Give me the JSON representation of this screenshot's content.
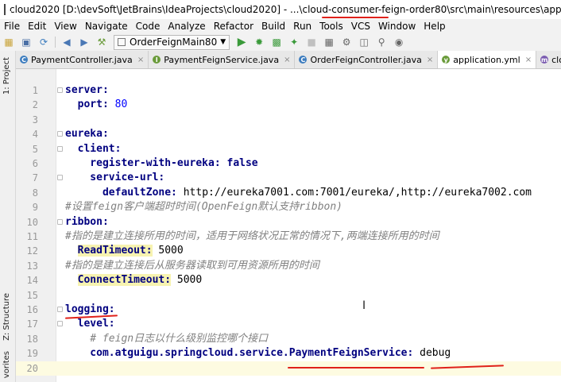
{
  "window": {
    "title_pre": "cloud2020 [D:\\devSoft\\JetBrains\\IdeaProjects\\cloud2020] - ...\\cloud-consumer-",
    "title_hl": "feign-order80\\src",
    "title_post": "\\main\\resources\\application.yml [cloud-cons"
  },
  "menu": [
    "File",
    "Edit",
    "View",
    "Navigate",
    "Code",
    "Analyze",
    "Refactor",
    "Build",
    "Run",
    "Tools",
    "VCS",
    "Window",
    "Help"
  ],
  "toolbar": {
    "run_config": "OrderFeignMain80"
  },
  "sidebar": {
    "project_label": "1: Project",
    "structure_label": "Z: Structure",
    "favorites_label": "vorites"
  },
  "tabs": [
    {
      "label": "PaymentController.java",
      "icon": "class-icon",
      "color": "#3d7dbf"
    },
    {
      "label": "PaymentFeignService.java",
      "icon": "interface-icon",
      "color": "#6a9b3a"
    },
    {
      "label": "OrderFeignController.java",
      "icon": "class-icon",
      "color": "#3d7dbf"
    },
    {
      "label": "application.yml",
      "icon": "yaml-icon",
      "color": "#6a9b3a",
      "active": true
    },
    {
      "label": "cloud-consum",
      "icon": "maven-icon",
      "color": "#7a5bb0"
    }
  ],
  "editor": {
    "lines": [
      {
        "n": "1",
        "parts": [
          {
            "t": "server:",
            "c": "k"
          }
        ]
      },
      {
        "n": "2",
        "parts": [
          {
            "t": "  port: ",
            "c": "k"
          },
          {
            "t": "80",
            "c": "v"
          }
        ]
      },
      {
        "n": "3",
        "parts": []
      },
      {
        "n": "4",
        "parts": [
          {
            "t": "eureka:",
            "c": "k"
          }
        ]
      },
      {
        "n": "5",
        "parts": [
          {
            "t": "  client:",
            "c": "k"
          }
        ]
      },
      {
        "n": "6",
        "parts": [
          {
            "t": "    register-with-eureka: ",
            "c": "k"
          },
          {
            "t": "false",
            "c": "k"
          }
        ]
      },
      {
        "n": "7",
        "parts": [
          {
            "t": "    service-url:",
            "c": "k"
          }
        ]
      },
      {
        "n": "8",
        "parts": [
          {
            "t": "      defaultZone: ",
            "c": "k"
          },
          {
            "t": "http://eureka7001.com:7001/eureka/,http://eureka7002.com",
            "c": "s"
          }
        ]
      },
      {
        "n": "9",
        "parts": [
          {
            "t": "#设置feign客户端超时时间(OpenFeign默认支持ribbon)",
            "c": "c"
          }
        ]
      },
      {
        "n": "10",
        "parts": [
          {
            "t": "ribbon:",
            "c": "k"
          }
        ]
      },
      {
        "n": "11",
        "parts": [
          {
            "t": "#指的是建立连接所用的时间，适用于网络状况正常的情况下,两端连接所用的时间",
            "c": "c"
          }
        ]
      },
      {
        "n": "12",
        "parts": [
          {
            "t": "  ",
            "c": "s"
          },
          {
            "t": "ReadTimeout:",
            "c": "hlkey"
          },
          {
            "t": " 5000",
            "c": "s"
          }
        ]
      },
      {
        "n": "13",
        "parts": [
          {
            "t": "#指的是建立连接后从服务器读取到可用资源所用的时间",
            "c": "c"
          }
        ]
      },
      {
        "n": "14",
        "parts": [
          {
            "t": "  ",
            "c": "s"
          },
          {
            "t": "ConnectTimeout:",
            "c": "hlkey"
          },
          {
            "t": " 5000",
            "c": "s"
          }
        ]
      },
      {
        "n": "15",
        "parts": []
      },
      {
        "n": "16",
        "parts": [
          {
            "t": "logging:",
            "c": "k"
          }
        ]
      },
      {
        "n": "17",
        "parts": [
          {
            "t": "  level:",
            "c": "k"
          }
        ]
      },
      {
        "n": "18",
        "parts": [
          {
            "t": "    # feign日志以什么级别监控哪个接口",
            "c": "c"
          }
        ]
      },
      {
        "n": "19",
        "parts": [
          {
            "t": "    com.atguigu.springcloud.service.PaymentFeignService: ",
            "c": "k"
          },
          {
            "t": "debug",
            "c": "s"
          }
        ]
      },
      {
        "n": "20",
        "parts": []
      }
    ],
    "current_line": 20
  }
}
